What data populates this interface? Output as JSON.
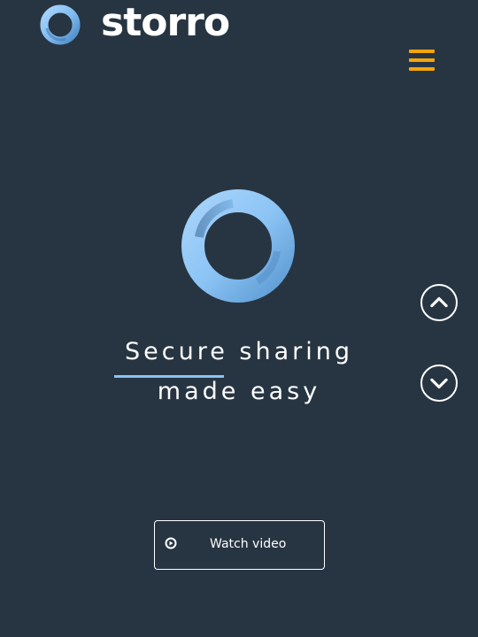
{
  "brand": {
    "name": "storro",
    "logo_icon": "ring-logo-icon"
  },
  "header": {
    "menu_icon": "hamburger-menu-icon"
  },
  "hero": {
    "icon": "ring-icon",
    "headline_line1": "Secure sharing",
    "headline_line2": "made easy"
  },
  "nav": {
    "up_icon": "chevron-up-icon",
    "down_icon": "chevron-down-icon"
  },
  "cta": {
    "watch_label": "Watch video",
    "icon": "play-icon"
  },
  "colors": {
    "background": "#273542",
    "accent": "#f5a50a",
    "ring": "#89c4f4",
    "text": "#ffffff"
  }
}
